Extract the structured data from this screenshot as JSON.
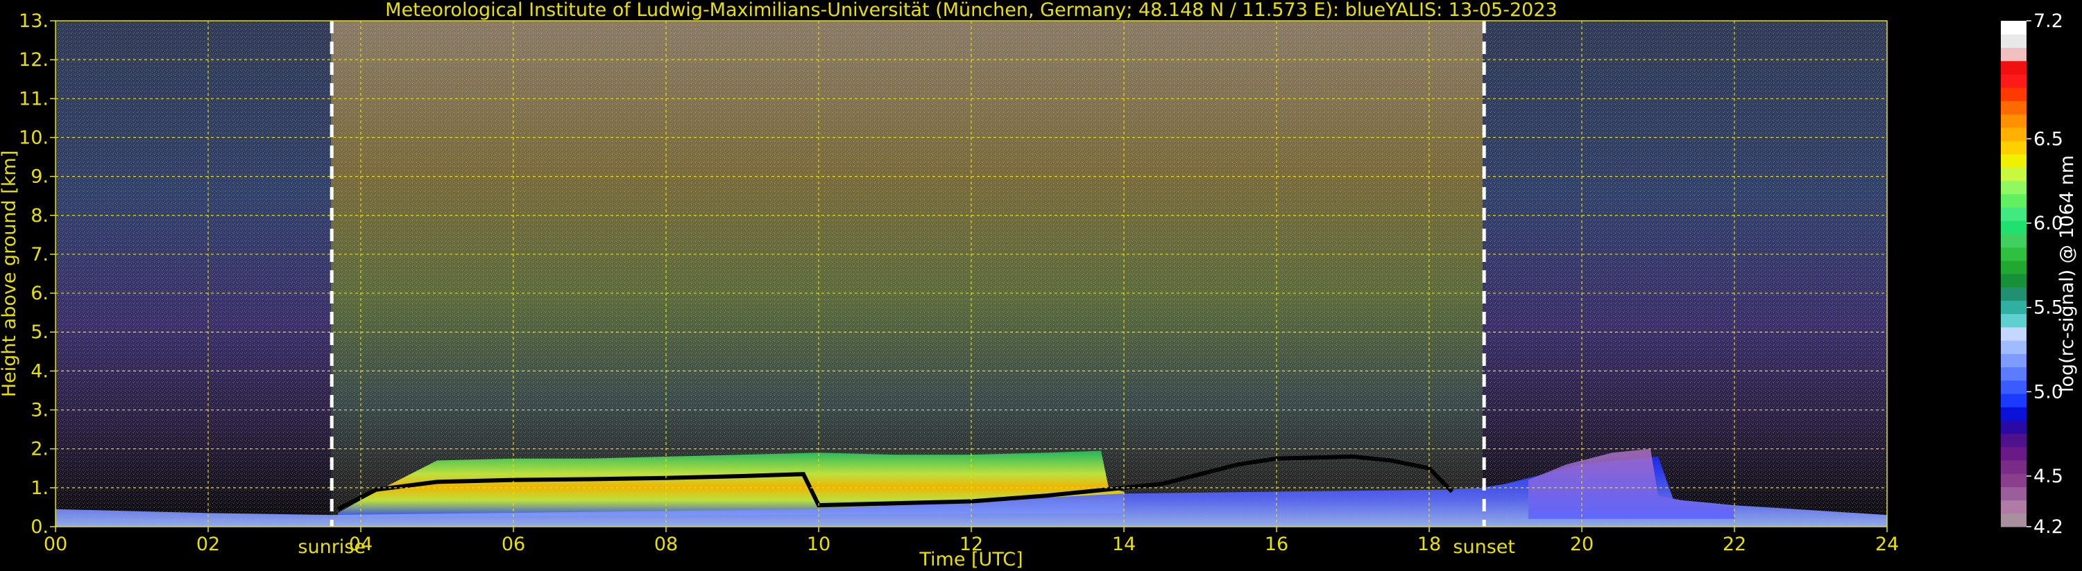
{
  "chart_data": {
    "type": "heatmap",
    "title": "Meteorological Institute of Ludwig-Maximilians-Universität (München, Germany; 48.148 N / 11.573 E):    blueYALIS: 13-05-2023",
    "xlabel": "Time [UTC]",
    "ylabel": "Height above ground [km]",
    "colorbar_label": "log(rc-signal) @ 1064 nm",
    "xlim": [
      0,
      24
    ],
    "ylim": [
      0,
      13
    ],
    "x_ticks": [
      "00",
      "02",
      "04",
      "06",
      "08",
      "10",
      "12",
      "14",
      "16",
      "18",
      "20",
      "22",
      "24"
    ],
    "y_ticks": [
      "0.",
      "1.",
      "2.",
      "3.",
      "4.",
      "5.",
      "6.",
      "7.",
      "8.",
      "9.",
      "10.",
      "11.",
      "12.",
      "13."
    ],
    "grid": true,
    "colorbar": {
      "range": [
        4.2,
        7.2
      ],
      "ticks": [
        {
          "value": 4.2,
          "label": "4.2"
        },
        {
          "value": 4.5,
          "label": "4.5"
        },
        {
          "value": 5.0,
          "label": "5.0"
        },
        {
          "value": 5.5,
          "label": "5.5"
        },
        {
          "value": 6.0,
          "label": "6.0"
        },
        {
          "value": 6.5,
          "label": "6.5"
        },
        {
          "value": 7.2,
          "label": "7.2"
        }
      ],
      "colors": [
        "#a9909f",
        "#b07ca6",
        "#9a5f9a",
        "#8a3f8c",
        "#7a2c86",
        "#6a1a86",
        "#50128c",
        "#2a0aa4",
        "#0a12d8",
        "#1a3aff",
        "#3a5cff",
        "#5c7cff",
        "#7e9cff",
        "#a0bcff",
        "#c4d8ff",
        "#5ed0d0",
        "#30b0a0",
        "#209070",
        "#189038",
        "#20a830",
        "#30c040",
        "#40d060",
        "#20e070",
        "#40ea80",
        "#60f060",
        "#90f860",
        "#c8f840",
        "#f0f000",
        "#ffd000",
        "#ffb000",
        "#ff9000",
        "#ff6a00",
        "#ff3a00",
        "#ff1a1a",
        "#f01010",
        "#f0c0c0",
        "#e8e8e8",
        "#ffffff"
      ]
    },
    "annotations": [
      {
        "label": "sunrise",
        "x": 3.62
      },
      {
        "label": "sunset",
        "x": 18.72
      }
    ]
  }
}
